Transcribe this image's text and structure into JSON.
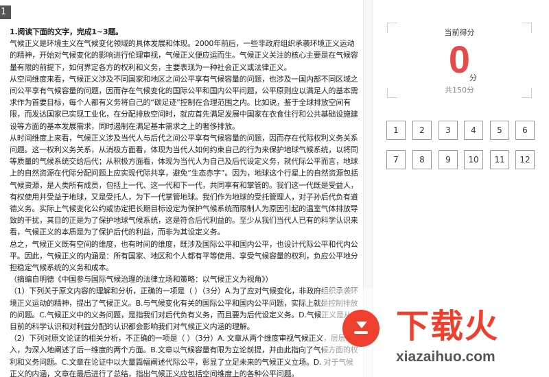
{
  "question_badge": "1",
  "article": {
    "paragraphs": [
      "1.阅读下面的文字，完成1~3题。",
      "气候正义是环境主义在气候变化领域的具体发展和体现。2000年前后，一些非政府组织承袭环境正义运动的精神，开始对气候变化的影响进行伦理审视，气候正义便应运而生。气候正义关注的核心主要是在气候容量有限的前提下，如何界定各方的权利和义务，主要表现为一种社会正义或法律正义。",
      "从空间维度来看，气候正义涉及不同国家和地区之间公平享有气候容量的问题，也涉及一国内部不同区域之间公平享有气候容量的问题，因而存在气候变化的国际公平和国内公平问题，公平原则应以满足人的基本需求作为首要目标，每个人都有义务将自己的“碳足迹”控制在合理范围之内。比如说，鉴于全球排放空间有限，而发达国家已实现工业化，在分配排放空间时，就应首先满足发展中国家在衣食住行和公共基础设施建设等方面的基本发展需求，同时遏制在满足基本需求之上的奢侈排放。",
      "从时间维度上来看，气候正义涉及当代人与后代之间公平享有气候容量的问题，因而存在代际权利义务关系问题。这一权利义务关系，从消极方面看，体现为当代人如何约束自己的行为来保护地球气候系统，以将同等质量的气候系统交给后代；从积极方面看，体现为当代人为自己及后代设定义务，就代际公平而言，地球上的自然资源在代际分配问题上应实现代际共享，避免“生态赤字”。因为，地球这个行星上的自然资源包括气候资源，是人类所有成员，包括上一代、这一代和下一代，共同享有和掌管的。我们这一代既是受益人，有权使用并受益于地球，又是受托人，为下一代掌管地球。我们作为地球的受托管理人，对子孙后代负有道德义务。实际上气候变化公约或协定把长期目标设定为保护气候系统而限制人为原因引起的温室气体排放导致的干扰，其目的正是为了保护地球气候系统，这是符合后代利益的。至少从我们当代人已有的科学认识来看，气候正义的本质是为了保护后代的利益，而非为其设定义务。",
      "总之，气候正义既有空间的维度，也有时间的维度，既涉及国际公平和国内公平，也设计代际公平和代内公平。因此，气候正义的内涵是：所有国家、地区和个人都有平等使用、享受气候容量的权利，负应公平地分担稳定气候系统的义务和成本。",
      "（摘编自明德《中国参与国际气候治理的法律立场和策略：以气候正义为视角》）",
      "（1）下列关于原文内容的理解和分析，正确的一项是（ ）（3分）A.为了应对气候变化，非政府组织承袭环境正义运动的精神，提出了气候正义。B.与气候变化有关的国际公平和国内公平问题，实际上就是控制排放的问题。C.气候正义中的义务问题，是指我们对后代负有义务，而且要为后代设定义务。D.气候正义是从目前的科学认识和对利益分配的认识都会影响我们对气候正义内涵的理解。",
      "（2）下列对原文论证的相关分析，不正确的一项是（ ）（3分）A. 文章从两个维度审视气候正义，层层深入，为深入地阐述了后一维度的两个方面。B.文章以气候容量有限为立论前提，并由此指向了气候方面的权利和义务问题。C.文章在论证中以大量篇幅阐述代际公平，彰显了立足未来的气候正义立场。D. 对于气候正义的内涵，文章在最后进行了总结，指出气候正义应包括空间维度上的各种公平问题。"
    ]
  },
  "score": {
    "label": "当前得分",
    "value": "0",
    "unit": "分",
    "total": "共150分"
  },
  "question_numbers": [
    "1",
    "2",
    "3",
    "4",
    "5",
    "6",
    "7",
    "8",
    "9",
    "10",
    "11",
    "12"
  ],
  "watermark": {
    "title": "下载火",
    "url": "xiazaihuo.com"
  }
}
